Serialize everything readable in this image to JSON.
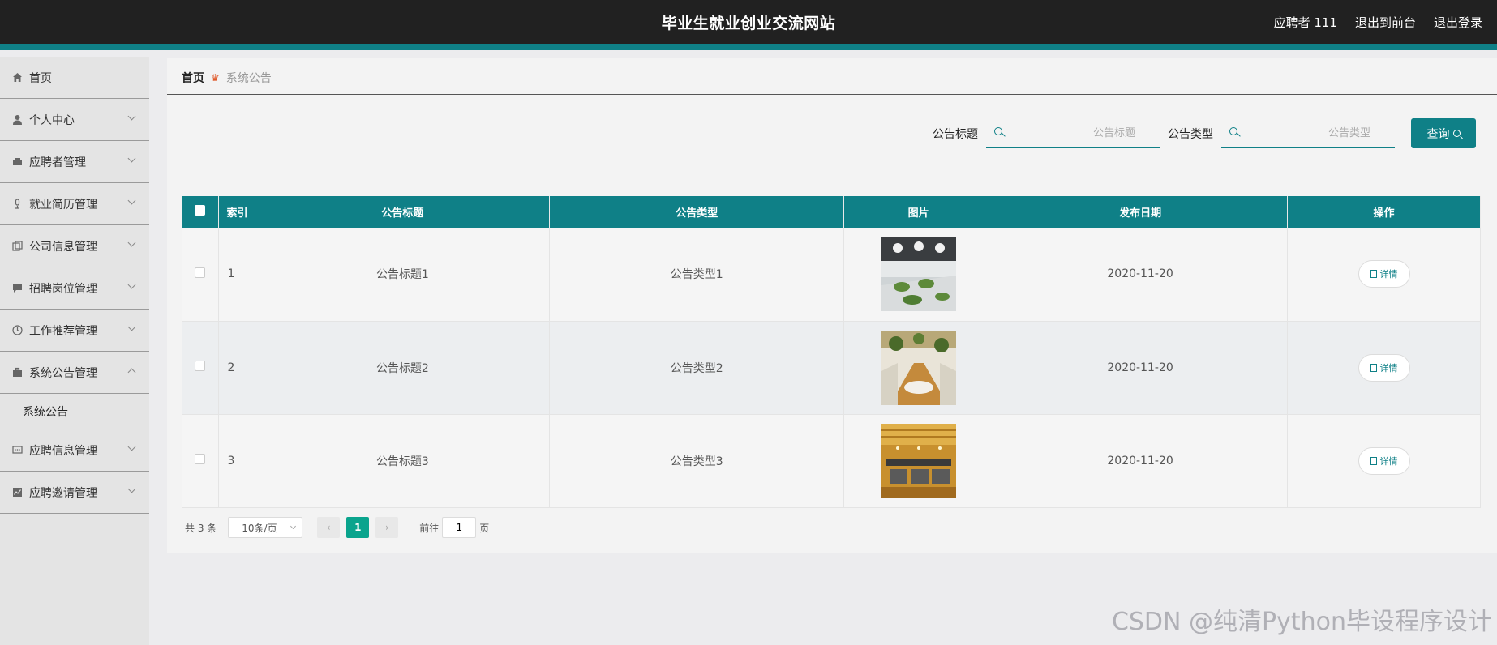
{
  "header": {
    "site_title": "毕业生就业创业交流网站",
    "user_label": "应聘者 111",
    "to_front_label": "退出到前台",
    "logout_label": "退出登录"
  },
  "sidebar": {
    "items": [
      {
        "label": "首页",
        "icon": "home-icon"
      },
      {
        "label": "个人中心",
        "icon": "user-icon"
      },
      {
        "label": "应聘者管理",
        "icon": "wallet-icon"
      },
      {
        "label": "就业简历管理",
        "icon": "microphone-icon"
      },
      {
        "label": "公司信息管理",
        "icon": "copy-icon"
      },
      {
        "label": "招聘岗位管理",
        "icon": "message-icon"
      },
      {
        "label": "工作推荐管理",
        "icon": "clock-icon"
      },
      {
        "label": "系统公告管理",
        "icon": "briefcase-icon",
        "expanded": true,
        "sub": "系统公告"
      },
      {
        "label": "应聘信息管理",
        "icon": "chat-dots-icon"
      },
      {
        "label": "应聘邀请管理",
        "icon": "chart-icon"
      }
    ]
  },
  "breadcrumb": {
    "home": "首页",
    "current": "系统公告"
  },
  "search": {
    "title_label": "公告标题",
    "title_placeholder": "公告标题",
    "type_label": "公告类型",
    "type_placeholder": "公告类型",
    "query_label": "查询"
  },
  "table": {
    "headers": [
      "索引",
      "公告标题",
      "公告类型",
      "图片",
      "发布日期",
      "操作"
    ],
    "rows": [
      {
        "index": "1",
        "title": "公告标题1",
        "type": "公告类型1",
        "date": "2020-11-20",
        "action": "详情"
      },
      {
        "index": "2",
        "title": "公告标题2",
        "type": "公告类型2",
        "date": "2020-11-20",
        "action": "详情"
      },
      {
        "index": "3",
        "title": "公告标题3",
        "type": "公告类型3",
        "date": "2020-11-20",
        "action": "详情"
      }
    ]
  },
  "pagination": {
    "total": "共 3 条",
    "page_size": "10条/页",
    "current_page": "1",
    "goto_label": "前往",
    "goto_value": "1",
    "page_suffix": "页"
  },
  "watermark": "CSDN @纯清Python毕设程序设计",
  "colors": {
    "accent": "#0f8087",
    "topbar": "#212121",
    "active_page": "#0aa48d"
  }
}
